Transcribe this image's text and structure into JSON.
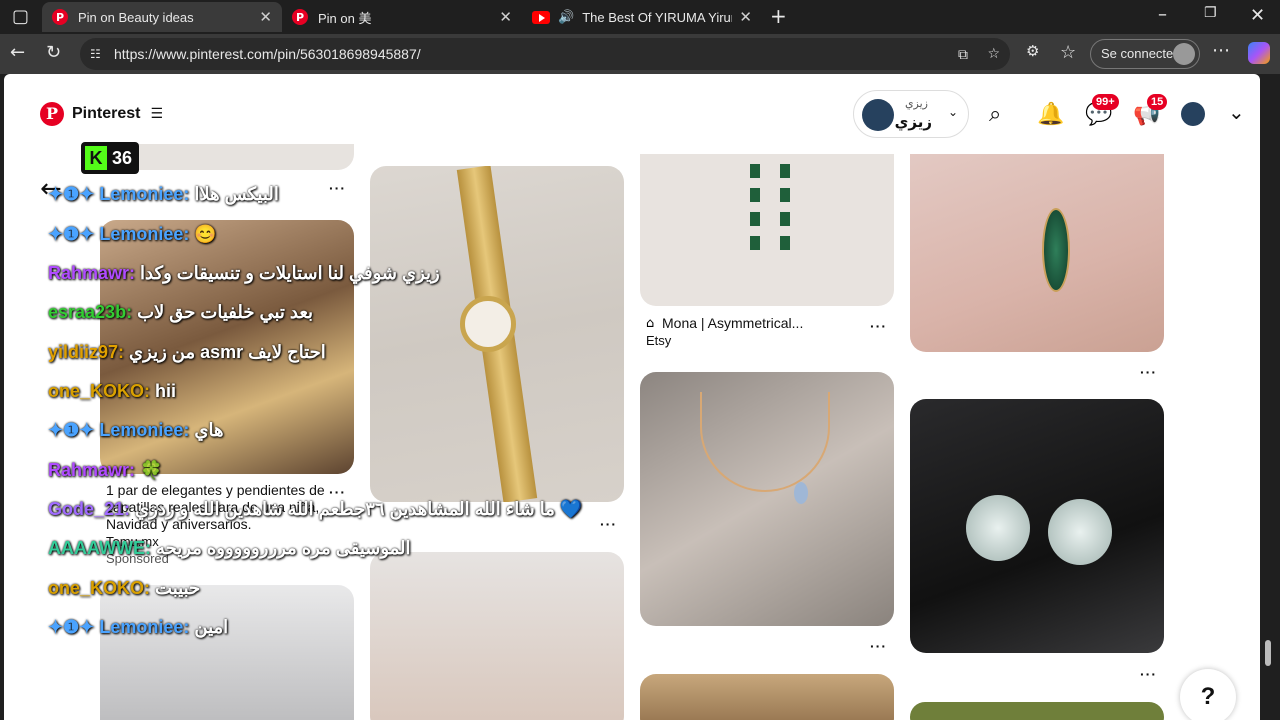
{
  "browser": {
    "tabs": [
      {
        "label": "Pin on Beauty ideas"
      },
      {
        "label": "Pin on 美"
      },
      {
        "label": "The Best Of YIRUMA Yiruma'"
      }
    ],
    "url": "https://www.pinterest.com/pin/563018698945887/",
    "signin_label": "Se connecter"
  },
  "pinterest": {
    "brand": "Pinterest",
    "user": {
      "name_small": "زيزي",
      "name_big": "زيزي"
    },
    "badges": {
      "messages": "99+",
      "updates": "15"
    },
    "help": "?"
  },
  "kick": {
    "count": "36"
  },
  "pins": {
    "mona_title": "Mona | Asymmetrical...",
    "mona_source": "Etsy",
    "earrings_desc": "1 par de elegantes y pendientes de zapatillas reales para de una niña, Navidad y aniversarios.",
    "earrings_source": "Temu.mx",
    "sponsored": "Sponsored"
  },
  "chat": [
    {
      "user": "Lemoniee:",
      "msg": "البيكس هلاا",
      "color": "#4aa3ff"
    },
    {
      "user": "Lemoniee:",
      "msg": "😊",
      "color": "#4aa3ff"
    },
    {
      "user": "Rahmawr:",
      "msg": "زيزي شوفي لنا استايلات و تنسيقات وكدا",
      "color": "#b04bff"
    },
    {
      "user": "esraa23b:",
      "msg": "بعد تبي خلفيات حق لاب",
      "color": "#33cc33"
    },
    {
      "user": "yildiiz97:",
      "msg": "من زيزي asmr احتاج لايف",
      "color": "#e0a000"
    },
    {
      "user": "one_KOKO:",
      "msg": "hii",
      "color": "#d9a000"
    },
    {
      "user": "Lemoniee:",
      "msg": "هاي",
      "color": "#4aa3ff"
    },
    {
      "user": "Rahmawr:",
      "msg": "🍀",
      "color": "#b04bff"
    },
    {
      "user": "Gode_21:",
      "msg": "ما شاء الله المشاهدين ٣٦جطعم الله شاهدين الله و زدزي 💙",
      "color": "#a06bff"
    },
    {
      "user": "AAAAWWE:",
      "msg": "الموسيقى مره مررروووووه مريحه",
      "color": "#33cc99"
    },
    {
      "user": "one_KOKO:",
      "msg": "حبيبت",
      "color": "#d9a000"
    },
    {
      "user": "Lemoniee:",
      "msg": "امين",
      "color": "#4aa3ff"
    }
  ]
}
